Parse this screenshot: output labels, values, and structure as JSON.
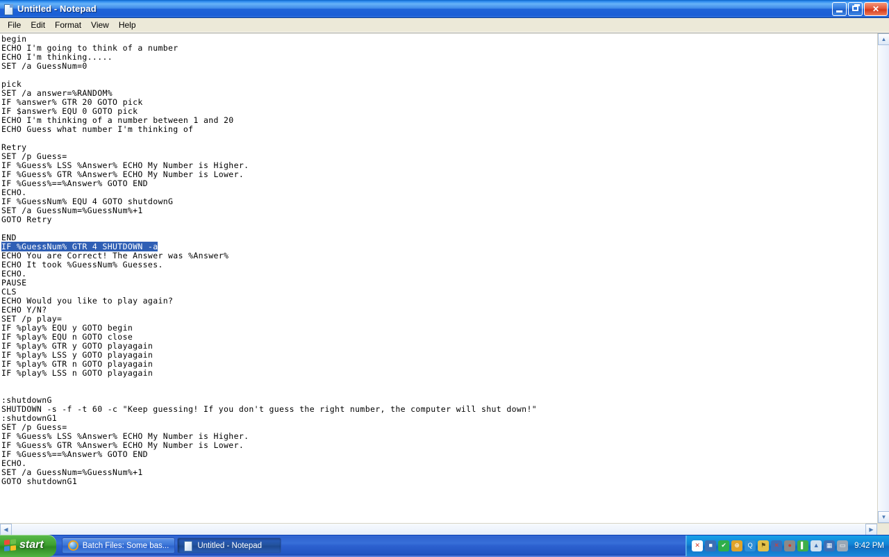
{
  "window": {
    "title": "Untitled - Notepad",
    "icon": "notepad-document-icon",
    "controls": {
      "minimize": "Minimize",
      "restore": "Restore Down",
      "close": "Close",
      "close_glyph": "✕"
    }
  },
  "menu": {
    "items": [
      {
        "label": "File"
      },
      {
        "label": "Edit"
      },
      {
        "label": "Format"
      },
      {
        "label": "View"
      },
      {
        "label": "Help"
      }
    ]
  },
  "editor": {
    "before_selection": "begin\nECHO I'm going to think of a number\nECHO I'm thinking.....\nSET /a GuessNum=0\n\npick\nSET /a answer=%RANDOM%\nIF %answer% GTR 20 GOTO pick\nIF $answer% EQU 0 GOTO pick\nECHO I'm thinking of a number between 1 and 20\nECHO Guess what number I'm thinking of\n\nRetry\nSET /p Guess=\nIF %Guess% LSS %Answer% ECHO My Number is Higher.\nIF %Guess% GTR %Answer% ECHO My Number is Lower.\nIF %Guess%==%Answer% GOTO END\nECHO.\nIF %GuessNum% EQU 4 GOTO shutdownG\nSET /a GuessNum=%GuessNum%+1\nGOTO Retry\n\nEND\n",
    "selected_line": "IF %GuessNum% GTR 4 SHUTDOWN -a",
    "after_selection": "\nECHO You are Correct! The Answer was %Answer%\nECHO It took %GuessNum% Guesses.\nECHO.\nPAUSE\nCLS\nECHO Would you like to play again?\nECHO Y/N?\nSET /p play=\nIF %play% EQU y GOTO begin\nIF %play% EQU n GOTO close\nIF %play% GTR y GOTO playagain\nIF %play% LSS y GOTO playagain\nIF %play% GTR n GOTO playagain\nIF %play% LSS n GOTO playagain\n\n\n:shutdownG\nSHUTDOWN -s -f -t 60 -c \"Keep guessing! If you don't guess the right number, the computer will shut down!\"\n:shutdownG1\nSET /p Guess=\nIF %Guess% LSS %Answer% ECHO My Number is Higher.\nIF %Guess% GTR %Answer% ECHO My Number is Lower.\nIF %Guess%==%Answer% GOTO END\nECHO.\nSET /a GuessNum=%GuessNum%+1\nGOTO shutdownG1",
    "selection_color": "#2f5fb5"
  },
  "scrollbars": {
    "vertical": {
      "up_glyph": "▲",
      "down_glyph": "▼"
    },
    "horizontal": {
      "left_glyph": "◀",
      "right_glyph": "▶"
    }
  },
  "taskbar": {
    "start_label": "start",
    "start_icon": "windows-flag-icon",
    "tasks": [
      {
        "label": "Batch Files: Some bas...",
        "icon": "internet-explorer-icon",
        "active": false
      },
      {
        "label": "Untitled - Notepad",
        "icon": "notepad-document-icon",
        "active": true
      }
    ],
    "tray": {
      "icons": [
        {
          "name": "document-error-icon",
          "glyph": "✕",
          "color": "#ffffff",
          "fg": "#d43b2a"
        },
        {
          "name": "network-connection-icon",
          "glyph": "■",
          "color": "#3b6fb5",
          "fg": "#ffffff"
        },
        {
          "name": "antivirus-shield-icon",
          "glyph": "✔",
          "color": "#2fae4a",
          "fg": "#ffffff"
        },
        {
          "name": "globe-network-icon",
          "glyph": "⊕",
          "color": "#e0a32a",
          "fg": "#ffffff"
        },
        {
          "name": "quicktime-icon",
          "glyph": "Q",
          "color": "#2f8fd8",
          "fg": "#ffffff"
        },
        {
          "name": "printer-icon",
          "glyph": "⚑",
          "color": "#e3c14a",
          "fg": "#5a4a12"
        },
        {
          "name": "network-disconnected-icon",
          "glyph": "✕",
          "color": "#3b6fb5",
          "fg": "#e03b2a"
        },
        {
          "name": "volume-muted-icon",
          "glyph": "●",
          "color": "#8a8a8a",
          "fg": "#d43b2a"
        },
        {
          "name": "battery-icon",
          "glyph": "▌",
          "color": "#3fae4a",
          "fg": "#ffffff"
        },
        {
          "name": "wireless-signal-icon",
          "glyph": "▲",
          "color": "#cfe0ef",
          "fg": "#3b6fb5"
        },
        {
          "name": "network-activity-icon",
          "glyph": "▦",
          "color": "#3b6fb5",
          "fg": "#ffffff"
        },
        {
          "name": "display-monitor-icon",
          "glyph": "▭",
          "color": "#9aa8b5",
          "fg": "#ffffff"
        }
      ],
      "clock": "9:42 PM"
    }
  }
}
